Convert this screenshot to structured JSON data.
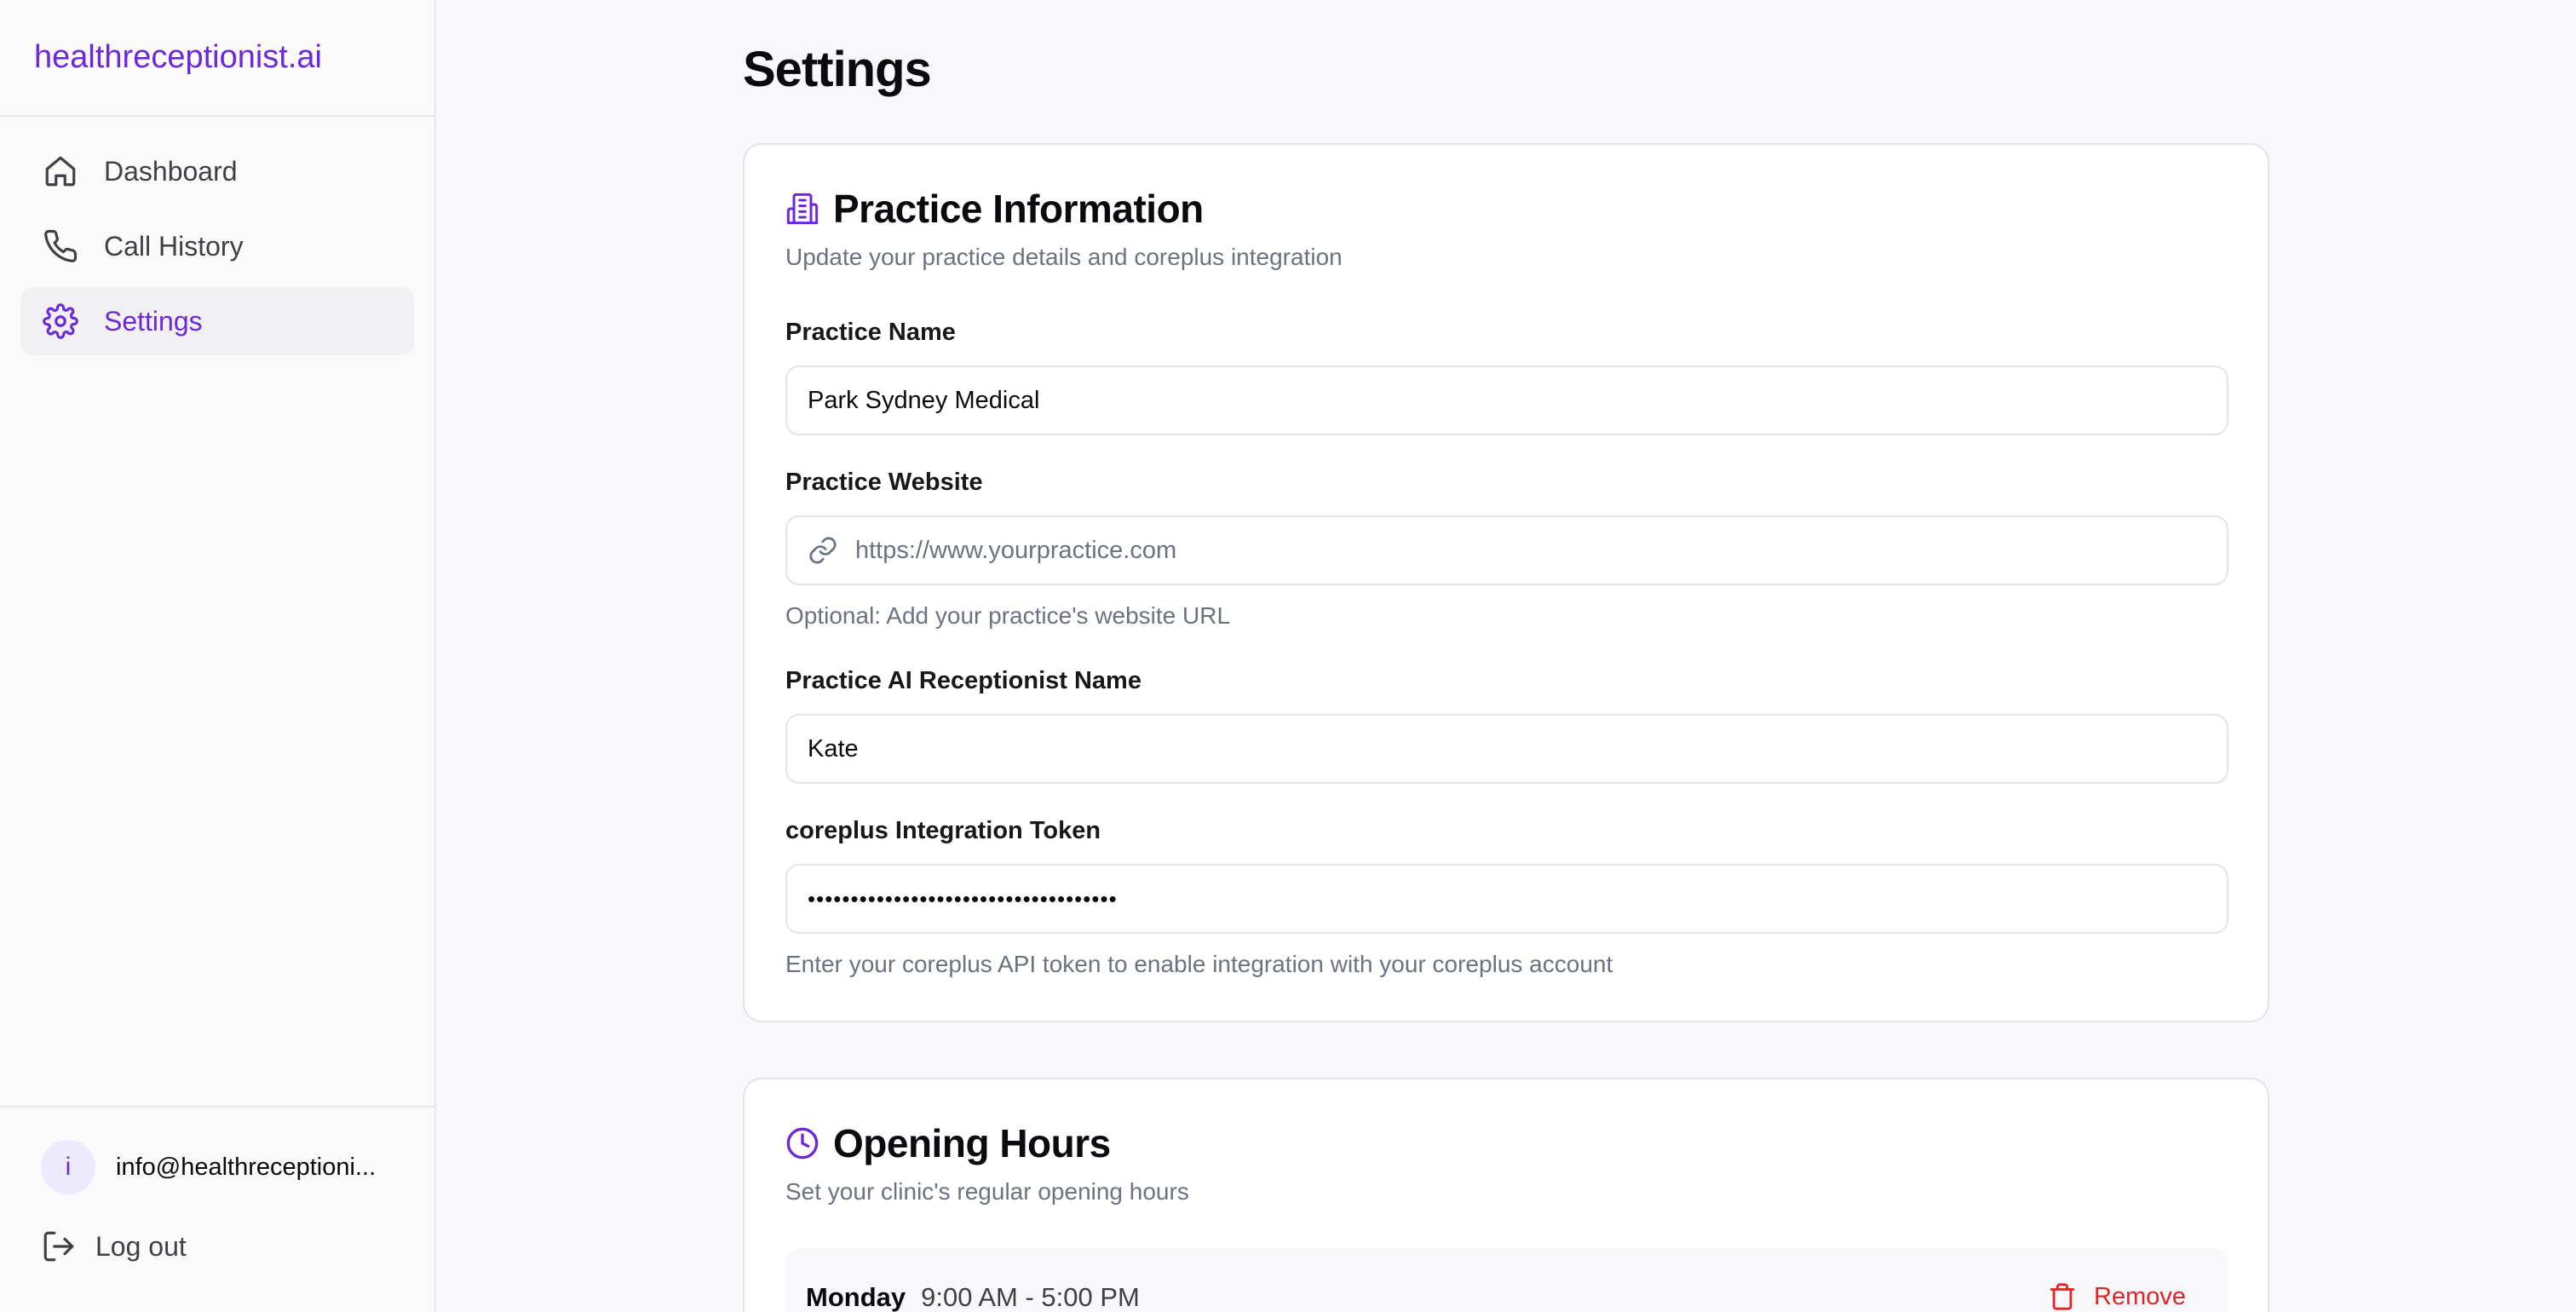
{
  "sidebar": {
    "brand": "healthreceptionist.ai",
    "items": [
      {
        "label": "Dashboard",
        "icon": "home-icon"
      },
      {
        "label": "Call History",
        "icon": "phone-icon"
      },
      {
        "label": "Settings",
        "icon": "gear-icon"
      }
    ],
    "user": {
      "avatar_letter": "i",
      "email": "info@healthreceptioni..."
    },
    "logout_label": "Log out"
  },
  "main": {
    "page_title": "Settings",
    "practice_card": {
      "title": "Practice Information",
      "description": "Update your practice details and coreplus integration",
      "fields": {
        "name": {
          "label": "Practice Name",
          "value": "Park Sydney Medical"
        },
        "website": {
          "label": "Practice Website",
          "placeholder": "https://www.yourpractice.com",
          "hint": "Optional: Add your practice's website URL"
        },
        "ai_name": {
          "label": "Practice AI Receptionist Name",
          "value": "Kate"
        },
        "token": {
          "label": "coreplus Integration Token",
          "value": "••••••••••••••••••••••••••••••••••••",
          "hint": "Enter your coreplus API token to enable integration with your coreplus account"
        }
      }
    },
    "hours_card": {
      "title": "Opening Hours",
      "description": "Set your clinic's regular opening hours",
      "rows": [
        {
          "day": "Monday",
          "hours": "9:00 AM - 5:00 PM",
          "remove_label": "Remove"
        }
      ]
    }
  },
  "colors": {
    "accent": "#6d28d9",
    "danger": "#dc2626",
    "muted_text": "#6b7280",
    "border": "#e4e4e7"
  }
}
